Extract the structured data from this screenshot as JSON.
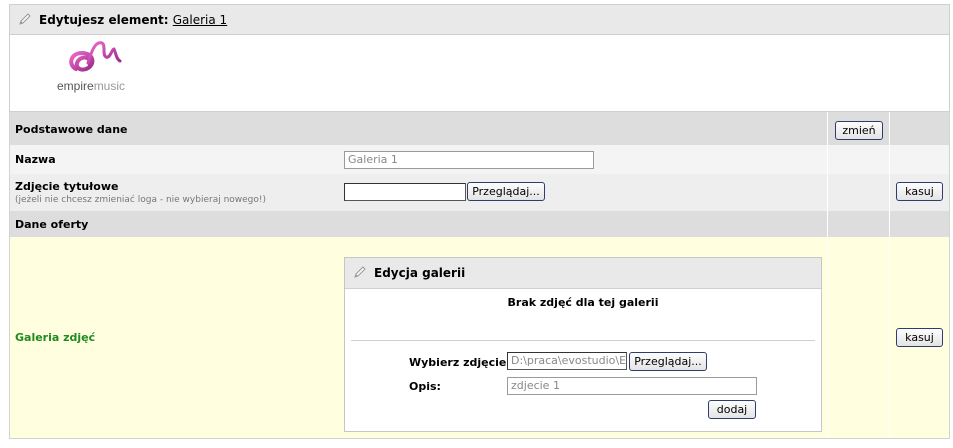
{
  "header": {
    "prefix": "Edytujesz element:",
    "element_name": "Galeria 1"
  },
  "logo": {
    "text_bold": "empire",
    "text_light": "music"
  },
  "section_basic": {
    "title": "Podstawowe dane",
    "change_label": "zmień"
  },
  "name_row": {
    "label": "Nazwa",
    "value": "Galeria 1"
  },
  "cover_row": {
    "label": "Zdjęcie tytułowe",
    "hint": "(jeżeli nie chcesz zmieniać loga - nie wybieraj nowego!)",
    "browse_label": "Przeglądaj...",
    "delete_label": "kasuj"
  },
  "section_offer": {
    "title": "Dane oferty"
  },
  "gallery_row": {
    "label": "Galeria zdjęć",
    "delete_label": "kasuj"
  },
  "gallery_panel": {
    "title": "Edycja galerii",
    "empty_message": "Brak zdjęć dla tej galerii",
    "choose_label": "Wybierz zdjęcie:",
    "file_value": "D:\\praca\\evostudio\\Emp",
    "browse_label": "Przeglądaj...",
    "desc_label": "Opis:",
    "desc_value": "zdjecie 1",
    "add_label": "dodaj"
  },
  "colors": {
    "accent_green": "#1f8a1f",
    "highlight_bg": "#ffffe0",
    "section_bg": "#dddddd"
  }
}
